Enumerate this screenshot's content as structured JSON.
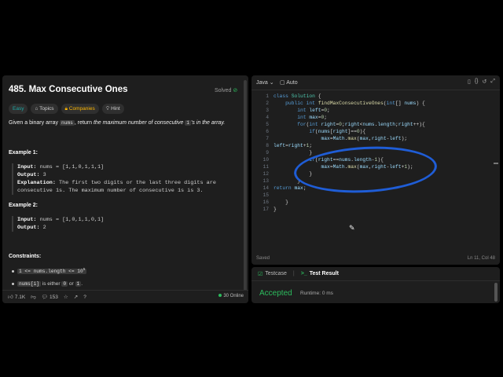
{
  "problem": {
    "title": "485. Max Consecutive Ones",
    "status": "Solved",
    "tags": [
      "Easy",
      "Topics",
      "Companies",
      "Hint"
    ],
    "desc_pre": "Given a binary array ",
    "desc_code1": "nums",
    "desc_mid": ", return ",
    "desc_em": "the maximum number of consecutive ",
    "desc_code2": "1",
    "desc_em2": "'s in the array.",
    "example1_heading": "Example 1:",
    "example1_input_label": "Input:",
    "example1_input": " nums = [1,1,0,1,1,1]",
    "example1_output_label": "Output:",
    "example1_output": " 3",
    "example1_expl_label": "Explanation:",
    "example1_expl_line1": " The first two digits or the last three digits are",
    "example1_expl_line2": "consecutive 1s. The maximum number of consecutive 1s is 3.",
    "example2_heading": "Example 2:",
    "example2_input_label": "Input:",
    "example2_input": " nums = [1,0,1,1,0,1]",
    "example2_output_label": "Output:",
    "example2_output": " 2",
    "constraints_heading": "Constraints:",
    "constraint1_code_a": "1 <= nums.length <= 10",
    "constraint1_sup": "5",
    "constraint2_code": "nums[i]",
    "constraint2_text": " is either ",
    "constraint2_code_b": "0",
    "constraint2_or": " or ",
    "constraint2_code_c": "1",
    "constraint2_end": "."
  },
  "bottom_bar": {
    "likes": "7.1K",
    "comments": "153",
    "online": "30 Online"
  },
  "editor": {
    "language": "Java",
    "mode": "Auto",
    "saved": "Saved",
    "position": "Ln 11, Col 48",
    "lines": [
      {
        "n": "1"
      },
      {
        "n": "2"
      },
      {
        "n": "3"
      },
      {
        "n": "4"
      },
      {
        "n": "5"
      },
      {
        "n": "6"
      },
      {
        "n": "7"
      },
      {
        "n": "8"
      },
      {
        "n": "9"
      },
      {
        "n": "10"
      },
      {
        "n": "11"
      },
      {
        "n": "12"
      },
      {
        "n": "13"
      },
      {
        "n": "14"
      },
      {
        "n": "15"
      },
      {
        "n": "16"
      },
      {
        "n": "17"
      }
    ]
  },
  "test_panel": {
    "tab_testcase": "Testcase",
    "tab_result": "Test Result",
    "verdict": "Accepted",
    "runtime": "Runtime: 0 ms"
  },
  "colors": {
    "accent_green": "#2cbb5d",
    "annotation_blue": "#1f5dd6",
    "easy_teal": "#1ca9a6",
    "companies_yellow": "#ffb800"
  }
}
